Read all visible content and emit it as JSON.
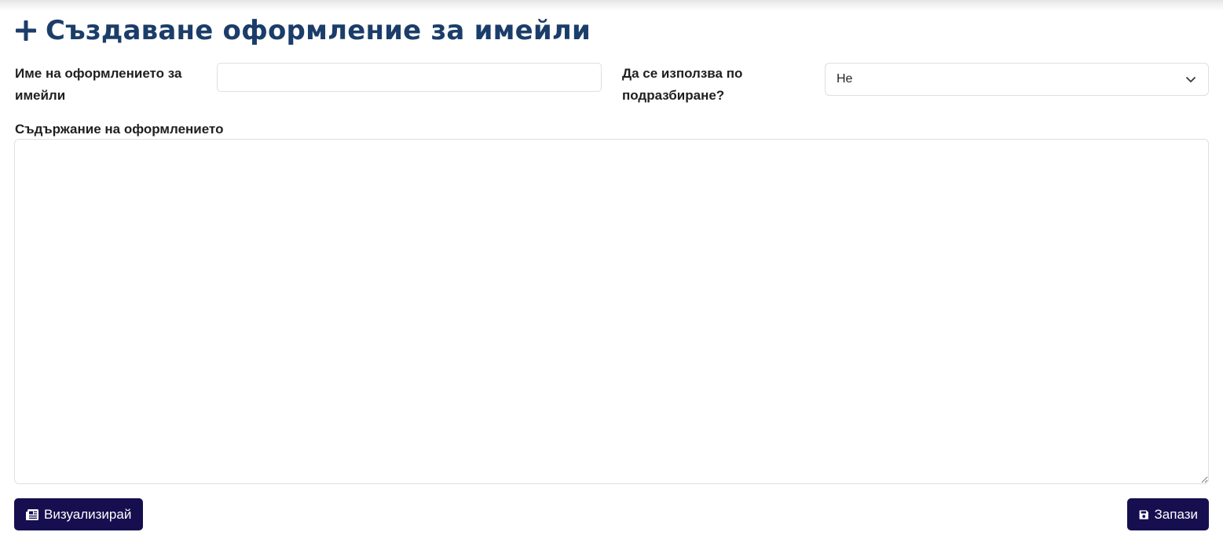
{
  "page": {
    "title": "Създаване оформление за имейли",
    "title_icon": "plus-icon"
  },
  "form": {
    "name_label": "Име на оформлението за имейли",
    "name_value": "",
    "default_label": "Да се използва по подразбиране?",
    "default_value": "Не",
    "content_label": "Съдържание на оформлението",
    "content_value": ""
  },
  "buttons": {
    "preview_label": "Визуализирай",
    "preview_icon": "newspaper-icon",
    "save_label": "Запази",
    "save_icon": "floppy-disk-icon"
  },
  "colors": {
    "title": "#1b3d6a",
    "button_bg": "#150f4f",
    "border": "#dcdfe4"
  }
}
